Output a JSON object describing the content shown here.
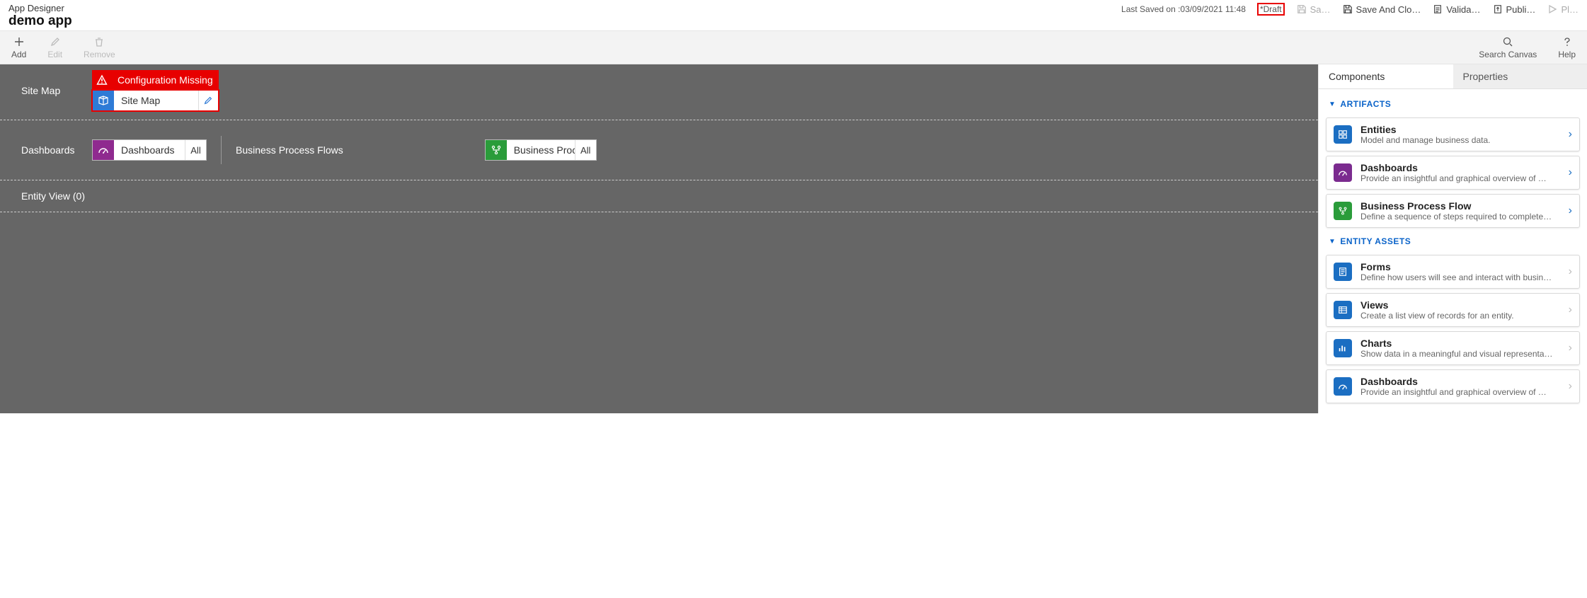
{
  "header": {
    "app_designer": "App Designer",
    "app_name": "demo app",
    "last_saved": "Last Saved on :03/09/2021 11:48",
    "draft": "*Draft",
    "actions": {
      "save": "Sa…",
      "save_close": "Save And Clo…",
      "validate": "Valida…",
      "publish": "Publi…",
      "play": "Pl…"
    }
  },
  "toolbar": {
    "add": "Add",
    "edit": "Edit",
    "remove": "Remove",
    "search": "Search Canvas",
    "help": "Help"
  },
  "canvas": {
    "config_missing": "Configuration Missing",
    "site_map_label": "Site Map",
    "site_map_tile": "Site Map",
    "dashboards_label": "Dashboards",
    "dashboards_tile": "Dashboards",
    "dashboards_pill": "All",
    "bpf_label": "Business Process Flows",
    "bpf_tile": "Business Proces…",
    "bpf_pill": "All",
    "entity_view": "Entity View (0)"
  },
  "panel": {
    "tabs": {
      "components": "Components",
      "properties": "Properties"
    },
    "sections": {
      "artifacts": "ARTIFACTS",
      "entity_assets": "ENTITY ASSETS"
    },
    "artifacts": [
      {
        "title": "Entities",
        "desc": "Model and manage business data.",
        "icon": "entities"
      },
      {
        "title": "Dashboards",
        "desc": "Provide an insightful and graphical overview of …",
        "icon": "dashboards"
      },
      {
        "title": "Business Process Flow",
        "desc": "Define a sequence of steps required to complete…",
        "icon": "bpf"
      }
    ],
    "assets": [
      {
        "title": "Forms",
        "desc": "Define how users will see and interact with busin…",
        "icon": "forms"
      },
      {
        "title": "Views",
        "desc": "Create a list view of records for an entity.",
        "icon": "views"
      },
      {
        "title": "Charts",
        "desc": "Show data in a meaningful and visual representa…",
        "icon": "charts"
      },
      {
        "title": "Dashboards",
        "desc": "Provide an insightful and graphical overview of …",
        "icon": "dash2"
      }
    ]
  }
}
